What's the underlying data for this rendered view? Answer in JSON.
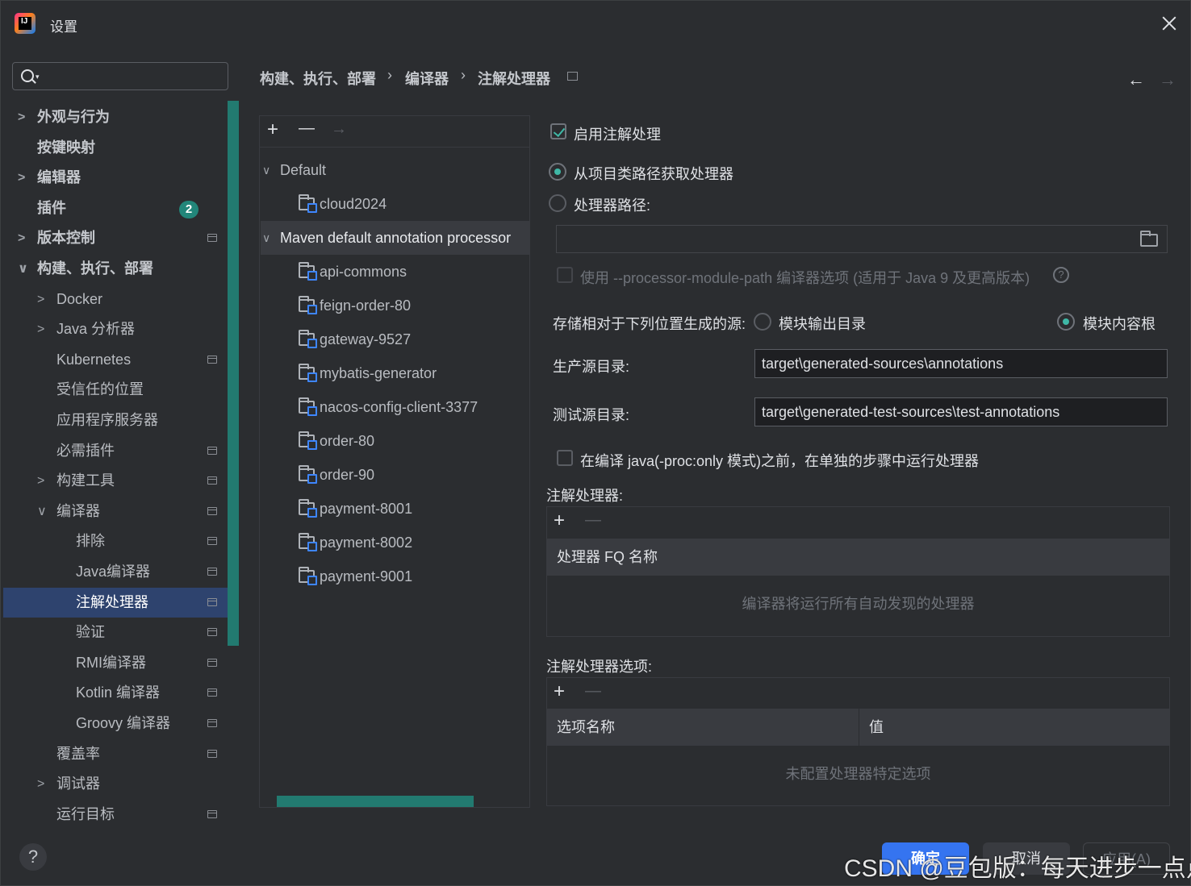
{
  "window": {
    "title": "设置",
    "icon": "intellij-idea-icon",
    "close": "close-icon"
  },
  "search": {
    "placeholder": "",
    "value": ""
  },
  "nav": {
    "items": [
      {
        "label": "外观与行为",
        "chevron": ">",
        "bold": true
      },
      {
        "label": "按键映射",
        "bold": true
      },
      {
        "label": "编辑器",
        "chevron": ">",
        "bold": true
      },
      {
        "label": "插件",
        "bold": true,
        "badge": "2"
      },
      {
        "label": "版本控制",
        "chevron": ">",
        "bold": true
      },
      {
        "label": "构建、执行、部署",
        "chevron": "∨",
        "bold": true
      },
      {
        "label": "Docker",
        "chevron": ">"
      },
      {
        "label": "Java 分析器",
        "chevron": ">"
      },
      {
        "label": "Kubernetes"
      },
      {
        "label": "受信任的位置"
      },
      {
        "label": "应用程序服务器"
      },
      {
        "label": "必需插件"
      },
      {
        "label": "构建工具",
        "chevron": ">"
      },
      {
        "label": "编译器",
        "chevron": "∨"
      },
      {
        "label": "排除"
      },
      {
        "label": "Java编译器"
      },
      {
        "label": "注解处理器",
        "selected": true
      },
      {
        "label": "验证"
      },
      {
        "label": "RMI编译器"
      },
      {
        "label": "Kotlin 编译器"
      },
      {
        "label": "Groovy 编译器"
      },
      {
        "label": "覆盖率"
      },
      {
        "label": "调试器",
        "chevron": ">"
      },
      {
        "label": "运行目标"
      }
    ]
  },
  "breadcrumb": [
    "构建、执行、部署",
    "编译器",
    "注解处理器"
  ],
  "breadcrumb_sep": "›",
  "nav_arrows": {
    "back": "←",
    "forward": "→"
  },
  "tree": {
    "toolbar": {
      "add": "+",
      "remove": "—",
      "move": "→"
    },
    "groups": [
      {
        "label": "Default",
        "chevron": "∨",
        "children": [
          "cloud2024"
        ]
      },
      {
        "label": "Maven default annotation processor",
        "chevron": "∨",
        "selected": true,
        "children": [
          "api-commons",
          "feign-order-80",
          "gateway-9527",
          "mybatis-generator",
          "nacos-config-client-3377",
          "order-80",
          "order-90",
          "payment-8001",
          "payment-8002",
          "payment-9001"
        ]
      }
    ]
  },
  "settings": {
    "enable_annotation": "启用注解处理",
    "enable_checked": true,
    "from_classpath": "从项目类路径获取处理器",
    "processor_path": "处理器路径:",
    "processor_path_value": "",
    "use_module_path": "使用 --processor-module-path 编译器选项 (适用于 Java 9 及更高版本)",
    "help": "?",
    "store_relative": "存储相对于下列位置生成的源:",
    "module_output": "模块输出目录",
    "module_content_root": "模块内容根",
    "prod_src_label": "生产源目录:",
    "prod_src_value": "target\\generated-sources\\annotations",
    "test_src_label": "测试源目录:",
    "test_src_value": "target\\generated-test-sources\\test-annotations",
    "run_separately": "在编译 java(-proc:only 模式)之前，在单独的步骤中运行处理器",
    "processors_label": "注解处理器:",
    "processors_col": "处理器 FQ 名称",
    "processors_empty": "编译器将运行所有自动发现的处理器",
    "options_label": "注解处理器选项:",
    "options_col_name": "选项名称",
    "options_col_value": "值",
    "options_empty": "未配置处理器特定选项",
    "add": "+",
    "remove": "—"
  },
  "footer": {
    "help": "?",
    "ok": "确定",
    "cancel": "取消",
    "apply": "应用(A)"
  },
  "watermark": "CSDN @豆包版：每天进步一点点"
}
